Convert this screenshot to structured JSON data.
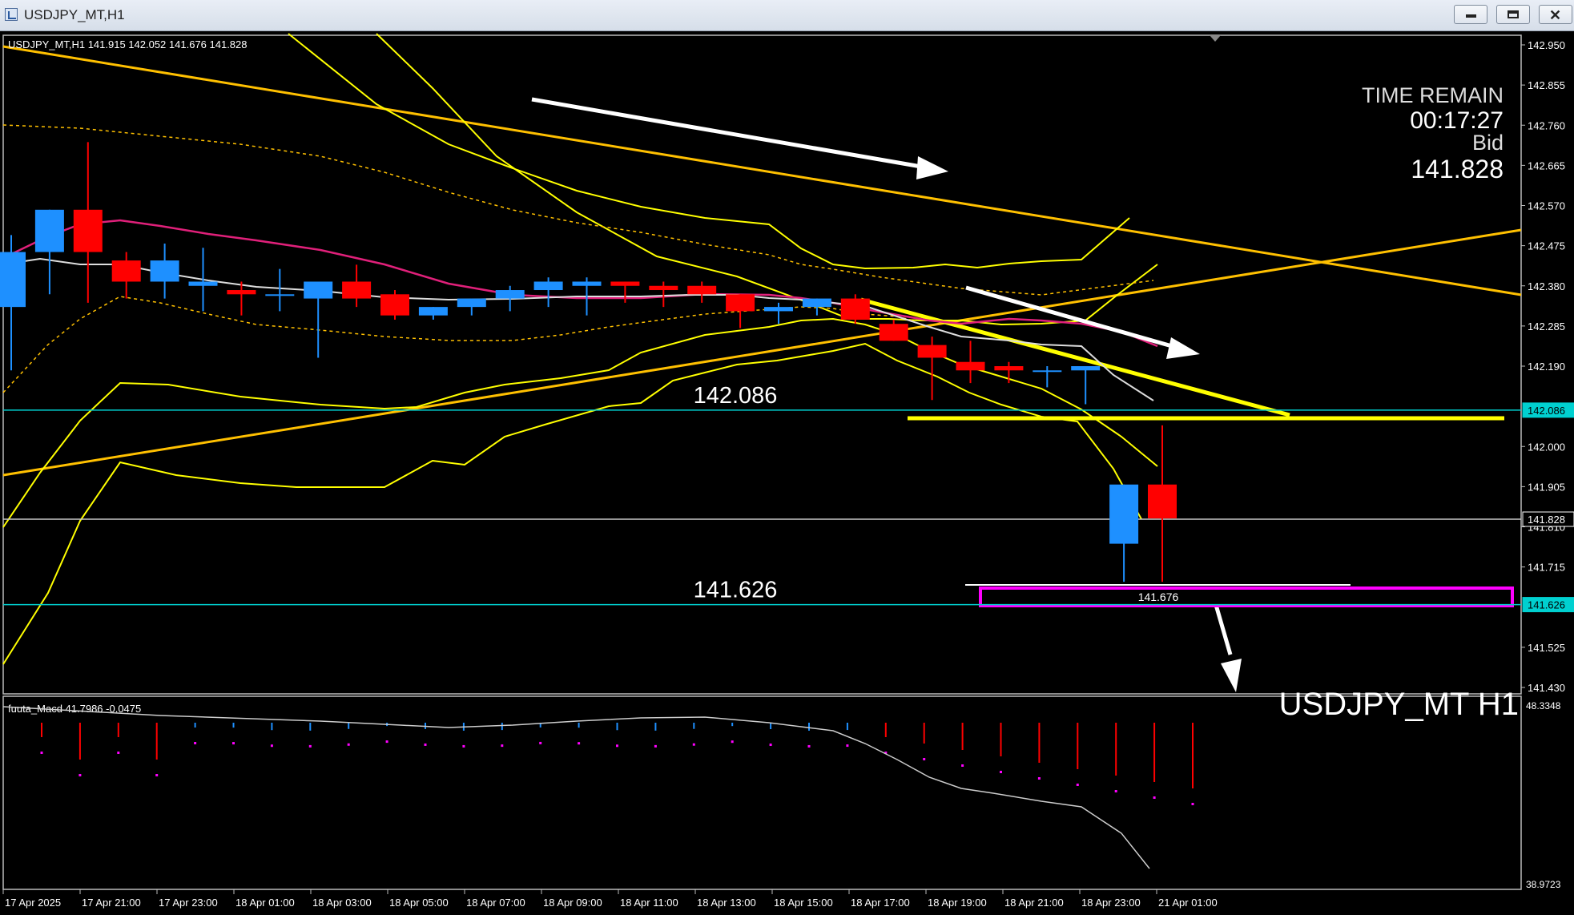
{
  "window": {
    "title": "USDJPY_MT,H1",
    "buttons": {
      "minimize": "minimize",
      "maximize": "maximize",
      "close": "✕"
    }
  },
  "chart_data": {
    "type": "candlestick",
    "symbol_label": "USDJPY_MT H1",
    "ohlc_header": "USDJPY_MT,H1  141.915 142.052 141.676 141.828",
    "info": {
      "time_remain_label": "TIME REMAIN",
      "time_remain": "00:17:27",
      "bid_label": "Bid",
      "bid": "141.828"
    },
    "price_axis": {
      "min": 141.43,
      "max": 142.95,
      "ticks": [
        "142.950",
        "142.855",
        "142.760",
        "142.665",
        "142.570",
        "142.475",
        "142.380",
        "142.285",
        "142.190",
        "142.000",
        "141.905",
        "141.810",
        "141.715",
        "141.525",
        "141.430"
      ],
      "markers": [
        {
          "value": "142.086",
          "color": "#00d0d0"
        },
        {
          "value": "141.828",
          "color": "#ffffff"
        },
        {
          "value": "141.626",
          "color": "#00d0d0"
        }
      ]
    },
    "time_axis": [
      "17 Apr 2025",
      "17 Apr 21:00",
      "17 Apr 23:00",
      "18 Apr 01:00",
      "18 Apr 03:00",
      "18 Apr 05:00",
      "18 Apr 07:00",
      "18 Apr 09:00",
      "18 Apr 11:00",
      "18 Apr 13:00",
      "18 Apr 15:00",
      "18 Apr 17:00",
      "18 Apr 19:00",
      "18 Apr 21:00",
      "18 Apr 23:00",
      "21 Apr 01:00"
    ],
    "candles": [
      {
        "o": 142.33,
        "h": 142.5,
        "l": 142.18,
        "c": 142.46
      },
      {
        "o": 142.46,
        "h": 142.56,
        "l": 142.36,
        "c": 142.56
      },
      {
        "o": 142.56,
        "h": 142.72,
        "l": 142.34,
        "c": 142.46
      },
      {
        "o": 142.44,
        "h": 142.46,
        "l": 142.35,
        "c": 142.39
      },
      {
        "o": 142.39,
        "h": 142.48,
        "l": 142.35,
        "c": 142.44
      },
      {
        "o": 142.38,
        "h": 142.47,
        "l": 142.32,
        "c": 142.39
      },
      {
        "o": 142.37,
        "h": 142.39,
        "l": 142.31,
        "c": 142.36
      },
      {
        "o": 142.36,
        "h": 142.42,
        "l": 142.32,
        "c": 142.36
      },
      {
        "o": 142.35,
        "h": 142.39,
        "l": 142.21,
        "c": 142.39
      },
      {
        "o": 142.39,
        "h": 142.43,
        "l": 142.33,
        "c": 142.35
      },
      {
        "o": 142.36,
        "h": 142.37,
        "l": 142.3,
        "c": 142.31
      },
      {
        "o": 142.31,
        "h": 142.33,
        "l": 142.3,
        "c": 142.33
      },
      {
        "o": 142.33,
        "h": 142.35,
        "l": 142.31,
        "c": 142.35
      },
      {
        "o": 142.35,
        "h": 142.38,
        "l": 142.32,
        "c": 142.37
      },
      {
        "o": 142.37,
        "h": 142.4,
        "l": 142.33,
        "c": 142.39
      },
      {
        "o": 142.38,
        "h": 142.4,
        "l": 142.31,
        "c": 142.39
      },
      {
        "o": 142.39,
        "h": 142.39,
        "l": 142.34,
        "c": 142.38
      },
      {
        "o": 142.38,
        "h": 142.39,
        "l": 142.33,
        "c": 142.37
      },
      {
        "o": 142.38,
        "h": 142.39,
        "l": 142.34,
        "c": 142.36
      },
      {
        "o": 142.36,
        "h": 142.36,
        "l": 142.28,
        "c": 142.32
      },
      {
        "o": 142.32,
        "h": 142.34,
        "l": 142.29,
        "c": 142.33
      },
      {
        "o": 142.33,
        "h": 142.35,
        "l": 142.31,
        "c": 142.35
      },
      {
        "o": 142.35,
        "h": 142.36,
        "l": 142.29,
        "c": 142.3
      },
      {
        "o": 142.29,
        "h": 142.3,
        "l": 142.25,
        "c": 142.25
      },
      {
        "o": 142.24,
        "h": 142.26,
        "l": 142.11,
        "c": 142.21
      },
      {
        "o": 142.2,
        "h": 142.25,
        "l": 142.15,
        "c": 142.18
      },
      {
        "o": 142.19,
        "h": 142.2,
        "l": 142.15,
        "c": 142.18
      },
      {
        "o": 142.18,
        "h": 142.19,
        "l": 142.14,
        "c": 142.18
      },
      {
        "o": 142.18,
        "h": 142.19,
        "l": 142.1,
        "c": 142.19
      },
      {
        "o": 141.77,
        "h": 141.91,
        "l": 141.68,
        "c": 141.91
      },
      {
        "o": 141.91,
        "h": 142.05,
        "l": 141.68,
        "c": 141.83
      }
    ],
    "levels": [
      {
        "value": 142.086,
        "label": "142.086",
        "color": "#00d0d0"
      },
      {
        "value": 141.626,
        "label": "141.626",
        "color": "#00d0d0"
      },
      {
        "value": 141.828,
        "label": "",
        "color": "#c8c8c8"
      }
    ],
    "low_box_label": "141.676",
    "indicator": {
      "label": "fuuta_Macd 41.7986 -0.0475",
      "axis_max": "48.3348",
      "axis_min": "38.9723"
    },
    "colors": {
      "bull": "#1e90ff",
      "bear": "#ff0000",
      "band": "#ffff00",
      "trendline": "#ffc000",
      "ma_pink": "#e0207a",
      "box": "#ff00ff"
    }
  }
}
